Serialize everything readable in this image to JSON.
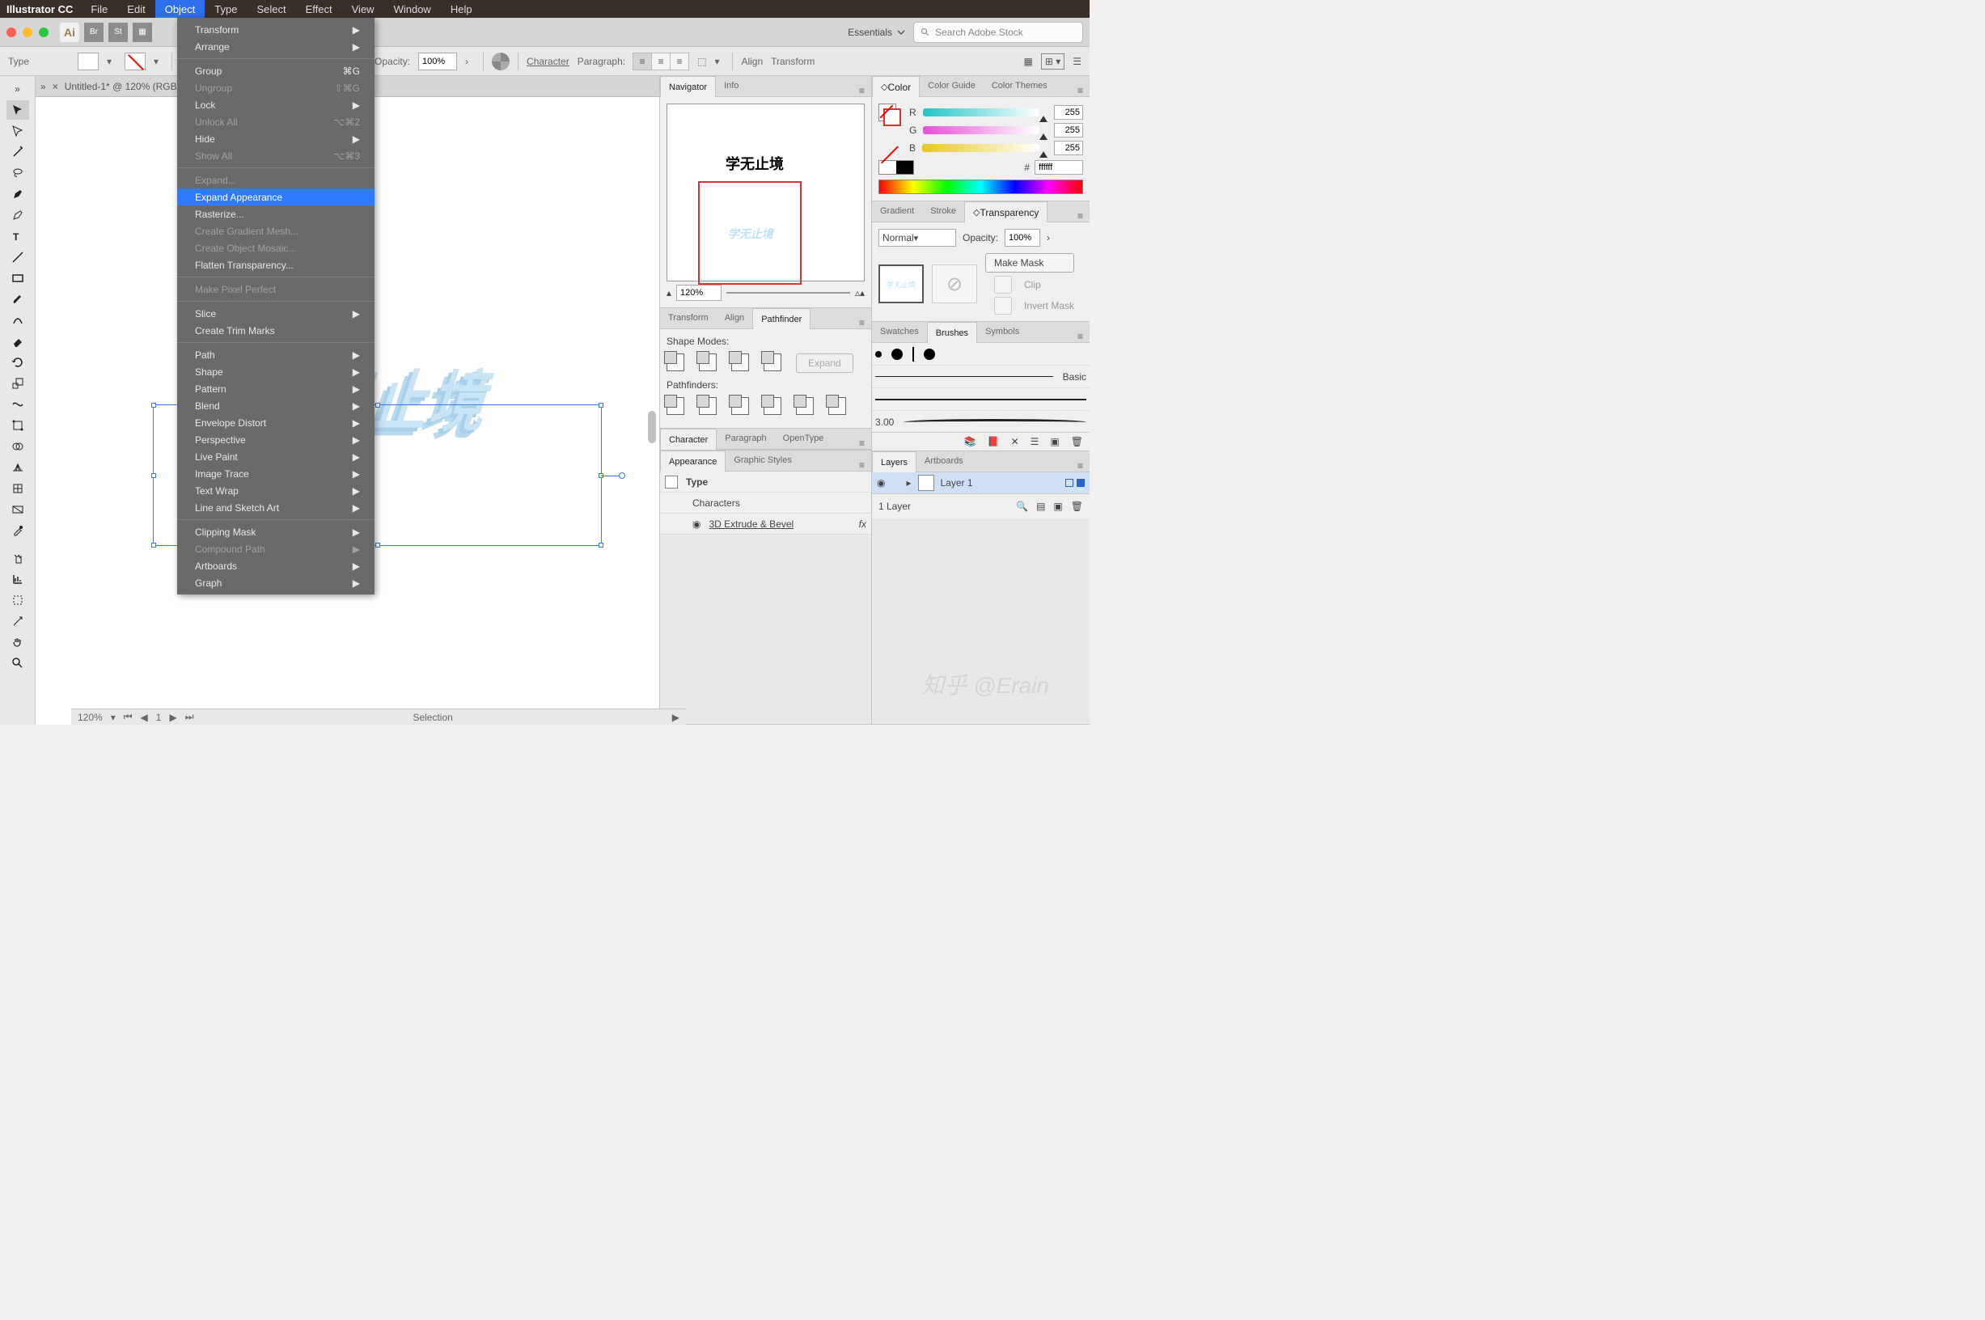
{
  "menubar": {
    "app": "Illustrator CC",
    "items": [
      "File",
      "Edit",
      "Object",
      "Type",
      "Select",
      "Effect",
      "View",
      "Window",
      "Help"
    ],
    "active_index": 2
  },
  "object_menu": [
    {
      "label": "Transform",
      "sub": true
    },
    {
      "label": "Arrange",
      "sub": true
    },
    {
      "sep": true
    },
    {
      "label": "Group",
      "shortcut": "⌘G"
    },
    {
      "label": "Ungroup",
      "shortcut": "⇧⌘G",
      "disabled": true
    },
    {
      "label": "Lock",
      "sub": true
    },
    {
      "label": "Unlock All",
      "shortcut": "⌥⌘2",
      "disabled": true
    },
    {
      "label": "Hide",
      "sub": true
    },
    {
      "label": "Show All",
      "shortcut": "⌥⌘3",
      "disabled": true
    },
    {
      "sep": true
    },
    {
      "label": "Expand...",
      "disabled": true
    },
    {
      "label": "Expand Appearance",
      "highlight": true
    },
    {
      "label": "Rasterize..."
    },
    {
      "label": "Create Gradient Mesh...",
      "disabled": true
    },
    {
      "label": "Create Object Mosaic...",
      "disabled": true
    },
    {
      "label": "Flatten Transparency..."
    },
    {
      "sep": true
    },
    {
      "label": "Make Pixel Perfect",
      "disabled": true
    },
    {
      "sep": true
    },
    {
      "label": "Slice",
      "sub": true
    },
    {
      "label": "Create Trim Marks"
    },
    {
      "sep": true
    },
    {
      "label": "Path",
      "sub": true
    },
    {
      "label": "Shape",
      "sub": true
    },
    {
      "label": "Pattern",
      "sub": true
    },
    {
      "label": "Blend",
      "sub": true
    },
    {
      "label": "Envelope Distort",
      "sub": true
    },
    {
      "label": "Perspective",
      "sub": true
    },
    {
      "label": "Live Paint",
      "sub": true
    },
    {
      "label": "Image Trace",
      "sub": true
    },
    {
      "label": "Text Wrap",
      "sub": true
    },
    {
      "label": "Line and Sketch Art",
      "sub": true
    },
    {
      "sep": true
    },
    {
      "label": "Clipping Mask",
      "sub": true
    },
    {
      "label": "Compound Path",
      "sub": true,
      "disabled": true
    },
    {
      "label": "Artboards",
      "sub": true
    },
    {
      "label": "Graph",
      "sub": true
    }
  ],
  "titlebar": {
    "workspace": "Essentials",
    "search_placeholder": "Search Adobe Stock"
  },
  "optbar": {
    "left_label": "Type",
    "opacity_label": "Opacity:",
    "opacity_value": "100%",
    "character": "Character",
    "paragraph": "Paragraph:",
    "align": "Align",
    "transform": "Transform"
  },
  "document": {
    "tab": "Untitled-1* @ 120% (RGB/",
    "sample_text": "学无止境"
  },
  "footer": {
    "zoom": "120%",
    "page": "1",
    "selection": "Selection"
  },
  "panelsA": {
    "navigator": {
      "tabs": [
        "Navigator",
        "Info"
      ],
      "zoom": "120%",
      "thumb_text": "学无止境"
    },
    "transform_align": {
      "tabs": [
        "Transform",
        "Align",
        "Pathfinder"
      ],
      "shape_modes": "Shape Modes:",
      "pathfinders": "Pathfinders:",
      "expand": "Expand"
    },
    "character": {
      "tabs": [
        "Character",
        "Paragraph",
        "OpenType"
      ]
    },
    "appearance": {
      "tabs": [
        "Appearance",
        "Graphic Styles"
      ],
      "rows": [
        "Type",
        "Characters",
        "3D Extrude & Bevel"
      ]
    }
  },
  "panelsB": {
    "color": {
      "tabs": [
        "Color",
        "Color Guide",
        "Color Themes"
      ],
      "r": "255",
      "g": "255",
      "b": "255",
      "hex_label": "#",
      "hex": "ffffff"
    },
    "gradient": {
      "tabs": [
        "Gradient",
        "Stroke",
        "Transparency"
      ],
      "mode": "Normal",
      "opacity_label": "Opacity:",
      "opacity": "100%",
      "make_mask": "Make Mask",
      "clip": "Clip",
      "invert": "Invert Mask"
    },
    "brushes": {
      "tabs": [
        "Swatches",
        "Brushes",
        "Symbols"
      ],
      "basic": "Basic",
      "val": "3.00"
    },
    "layers": {
      "tabs": [
        "Layers",
        "Artboards"
      ],
      "layer1": "Layer 1",
      "count": "1 Layer"
    }
  },
  "watermark": "知乎 @Erain"
}
